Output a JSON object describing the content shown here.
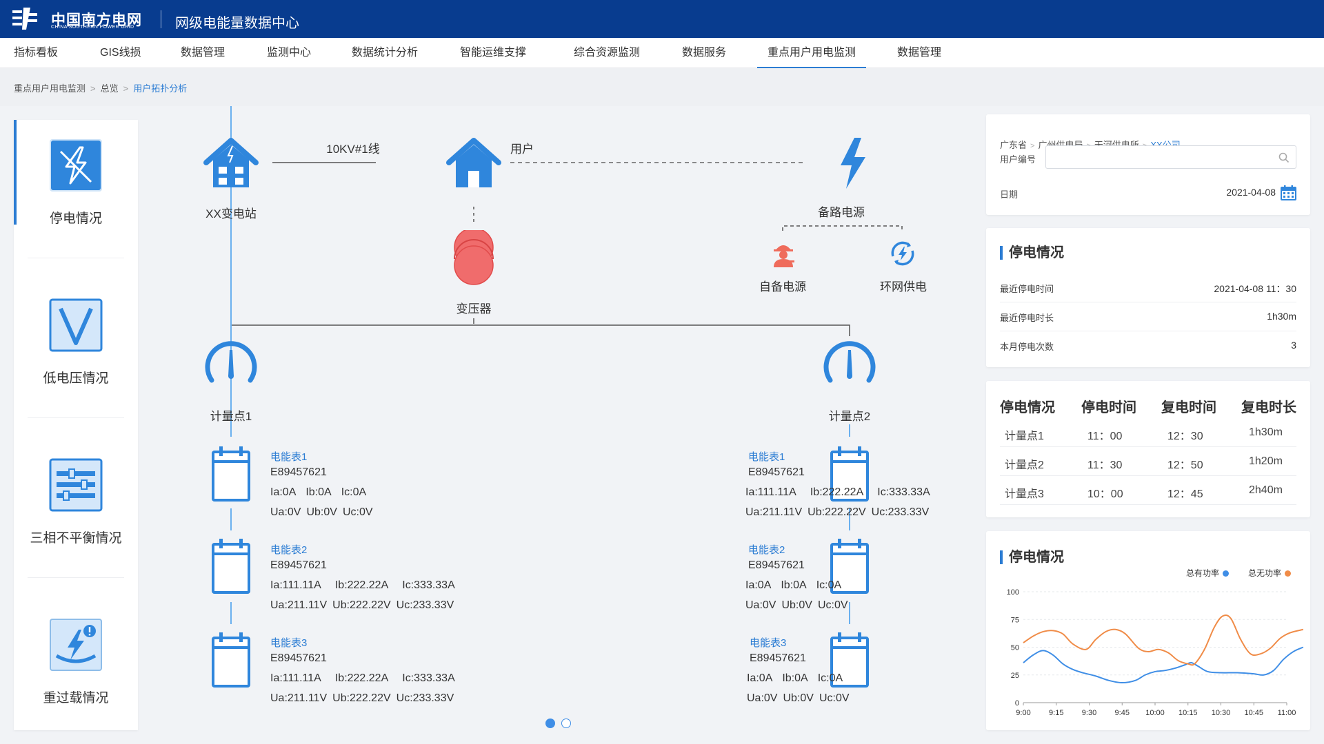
{
  "header": {
    "logo_cn": "中国南方电网",
    "logo_en": "CHINA SOUTHERN POWER GRID",
    "app_title": "网级电能量数据中心"
  },
  "nav": {
    "items": [
      {
        "label": "指标看板",
        "active": false
      },
      {
        "label": "GIS线损",
        "active": false
      },
      {
        "label": "数据管理",
        "active": false
      },
      {
        "label": "监测中心",
        "active": false
      },
      {
        "label": "数据统计分析",
        "active": false
      },
      {
        "label": "智能运维支撑",
        "active": false
      },
      {
        "label": "综合资源监测",
        "active": false
      },
      {
        "label": "数据服务",
        "active": false
      },
      {
        "label": "重点用户用电监测",
        "active": true
      },
      {
        "label": "数据管理",
        "active": false
      }
    ]
  },
  "breadcrumb": {
    "items": [
      "重点用户用电监测",
      "总览",
      "用户拓扑分析"
    ],
    "separator": ">"
  },
  "sidebar": {
    "items": [
      {
        "label": "停电情况",
        "icon": "power-outage-icon",
        "active": true
      },
      {
        "label": "低电压情况",
        "icon": "low-voltage-icon",
        "active": false
      },
      {
        "label": "三相不平衡情况",
        "icon": "three-phase-icon",
        "active": false
      },
      {
        "label": "重过载情况",
        "icon": "overload-icon",
        "active": false
      }
    ]
  },
  "topology": {
    "substation": "XX变电站",
    "line": "10KV#1线",
    "user": "用户",
    "backup": "备路电源",
    "self_power": "自备电源",
    "ring_power": "环网供电",
    "transformer": "变压器",
    "points": [
      {
        "name": "计量点1",
        "meters": [
          {
            "name": "电能表1",
            "id": "E89457621",
            "current": [
              "Ia:0A",
              "Ib:0A",
              "Ic:0A"
            ],
            "voltage": [
              "Ua:0V",
              "Ub:0V",
              "Uc:0V"
            ]
          },
          {
            "name": "电能表2",
            "id": "E89457621",
            "current": [
              "Ia:111.11A",
              "Ib:222.22A",
              "Ic:333.33A"
            ],
            "voltage": [
              "Ua:211.11V",
              "Ub:222.22V",
              "Uc:233.33V"
            ]
          },
          {
            "name": "电能表3",
            "id": "E89457621",
            "current": [
              "Ia:111.11A",
              "Ib:222.22A",
              "Ic:333.33A"
            ],
            "voltage": [
              "Ua:211.11V",
              "Ub:222.22V",
              "Uc:233.33V"
            ]
          }
        ]
      },
      {
        "name": "计量点2",
        "meters": [
          {
            "name": "电能表1",
            "id": "E89457621",
            "current": [
              "Ia:111.11A",
              "Ib:222.22A",
              "Ic:333.33A"
            ],
            "voltage": [
              "Ua:211.11V",
              "Ub:222.22V",
              "Uc:233.33V"
            ]
          },
          {
            "name": "电能表2",
            "id": "E89457621",
            "current": [
              "Ia:0A",
              "Ib:0A",
              "Ic:0A"
            ],
            "voltage": [
              "Ua:0V",
              "Ub:0V",
              "Uc:0V"
            ]
          },
          {
            "name": "电能表3",
            "id": "E89457621",
            "current": [
              "Ia:0A",
              "Ib:0A",
              "Ic:0A"
            ],
            "voltage": [
              "Ua:0V",
              "Ub:0V",
              "Uc:0V"
            ]
          }
        ]
      }
    ],
    "pager": {
      "pages": 2,
      "current": 1
    }
  },
  "filter": {
    "crumbs": [
      "广东省",
      "广州供电局",
      "天河供电所",
      "XX公司"
    ],
    "user_no_label": "用户编号",
    "user_no_value": "",
    "date_label": "日期",
    "date_value": "2021-04-08"
  },
  "outage": {
    "title": "停电情况",
    "rows": [
      {
        "k": "最近停电时间",
        "v": "2021-04-08 11：30"
      },
      {
        "k": "最近停电时长",
        "v": "1h30m"
      },
      {
        "k": "本月停电次数",
        "v": "3"
      }
    ]
  },
  "table": {
    "headers": [
      "停电情况",
      "停电时间",
      "复电时间",
      "复电时长"
    ],
    "rows": [
      [
        "计量点1",
        "11：00",
        "12：30",
        "1h30m"
      ],
      [
        "计量点2",
        "11：30",
        "12：50",
        "1h20m"
      ],
      [
        "计量点3",
        "10：00",
        "12：45",
        "2h40m"
      ]
    ]
  },
  "chart_card": {
    "title": "停电情况"
  },
  "chart_data": {
    "type": "line",
    "x": [
      "9:00",
      "9:15",
      "9:30",
      "9:45",
      "10:00",
      "10:15",
      "10:30",
      "10:45",
      "11:00"
    ],
    "ylim": [
      0,
      100
    ],
    "yticks": [
      0,
      25,
      50,
      75,
      100
    ],
    "grid": true,
    "legend_position": "top-right",
    "series": [
      {
        "name": "总有功率",
        "color": "#3f8ee6",
        "points": [
          [
            0,
            36
          ],
          [
            0.3,
            43
          ],
          [
            0.6,
            47
          ],
          [
            0.9,
            43
          ],
          [
            1.2,
            35
          ],
          [
            1.5,
            30
          ],
          [
            1.8,
            27
          ],
          [
            2.2,
            24
          ],
          [
            2.6,
            20
          ],
          [
            3.0,
            18
          ],
          [
            3.4,
            20
          ],
          [
            3.7,
            25
          ],
          [
            4.0,
            28
          ],
          [
            4.3,
            29
          ],
          [
            4.6,
            31
          ],
          [
            4.9,
            34
          ],
          [
            5.1,
            36
          ],
          [
            5.3,
            33
          ],
          [
            5.6,
            28
          ],
          [
            6.0,
            27
          ],
          [
            6.5,
            27
          ],
          [
            7.0,
            26
          ],
          [
            7.3,
            25
          ],
          [
            7.6,
            29
          ],
          [
            7.9,
            39
          ],
          [
            8.2,
            46
          ],
          [
            8.5,
            50
          ]
        ]
      },
      {
        "name": "总无功率",
        "color": "#f08c48",
        "points": [
          [
            0,
            54
          ],
          [
            0.3,
            60
          ],
          [
            0.6,
            64
          ],
          [
            0.9,
            65
          ],
          [
            1.2,
            62
          ],
          [
            1.5,
            53
          ],
          [
            1.9,
            48
          ],
          [
            2.2,
            57
          ],
          [
            2.5,
            64
          ],
          [
            2.8,
            66
          ],
          [
            3.1,
            62
          ],
          [
            3.5,
            49
          ],
          [
            3.8,
            46
          ],
          [
            4.1,
            48
          ],
          [
            4.4,
            45
          ],
          [
            4.7,
            38
          ],
          [
            5.0,
            35
          ],
          [
            5.2,
            35
          ],
          [
            5.5,
            48
          ],
          [
            5.8,
            68
          ],
          [
            6.05,
            78
          ],
          [
            6.3,
            76
          ],
          [
            6.6,
            57
          ],
          [
            6.9,
            44
          ],
          [
            7.2,
            44
          ],
          [
            7.5,
            49
          ],
          [
            7.8,
            58
          ],
          [
            8.1,
            63
          ],
          [
            8.5,
            66
          ]
        ]
      }
    ]
  },
  "colors": {
    "brand": "#083c8f",
    "accent": "#2b7cd3",
    "outage_red": "#f06c6c",
    "active_line": "#3f8ee6",
    "reactive_line": "#f08c48"
  }
}
